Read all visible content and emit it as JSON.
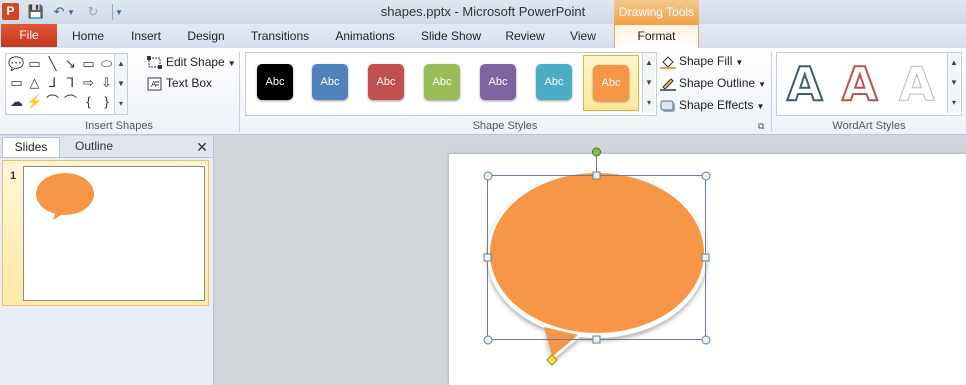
{
  "window": {
    "title": "shapes.pptx  -  Microsoft PowerPoint",
    "app_icon": "P",
    "contextual_group": "Drawing Tools"
  },
  "qat": {
    "save_icon": "💾",
    "undo_icon": "↶",
    "undo_dropdown": "▾",
    "redo_icon": "↻",
    "customize_icon": "▾"
  },
  "tabs": [
    {
      "label": "File"
    },
    {
      "label": "Home"
    },
    {
      "label": "Insert"
    },
    {
      "label": "Design"
    },
    {
      "label": "Transitions"
    },
    {
      "label": "Animations"
    },
    {
      "label": "Slide Show"
    },
    {
      "label": "Review"
    },
    {
      "label": "View"
    },
    {
      "label": "Format"
    }
  ],
  "ribbon": {
    "insert_shapes": {
      "label": "Insert Shapes",
      "shapes": [
        "💬",
        "▭",
        "╲",
        "↘",
        "▭",
        "⬭",
        "▭",
        "△",
        "⅃",
        "⅂",
        "⇨",
        "⇩",
        "☁",
        "⚡",
        "⌒",
        "⌒",
        "{",
        "}"
      ],
      "edit_shape": "Edit Shape",
      "text_box": "Text Box"
    },
    "shape_styles": {
      "label": "Shape Styles",
      "swatches": [
        {
          "text": "Abc",
          "color": "#000000"
        },
        {
          "text": "Abc",
          "color": "#4f81bd"
        },
        {
          "text": "Abc",
          "color": "#c0504d"
        },
        {
          "text": "Abc",
          "color": "#9bbb59"
        },
        {
          "text": "Abc",
          "color": "#8064a2"
        },
        {
          "text": "Abc",
          "color": "#4bacc6"
        },
        {
          "text": "Abc",
          "color": "#f79646"
        }
      ],
      "selected_index": 6,
      "shape_fill": "Shape Fill",
      "shape_outline": "Shape Outline",
      "shape_effects": "Shape Effects"
    },
    "wordart": {
      "label": "WordArt Styles",
      "letters": [
        "A",
        "A",
        "A"
      ]
    }
  },
  "slides_pane": {
    "tab_slides": "Slides",
    "tab_outline": "Outline",
    "close_icon": "✕",
    "slide_number": "1"
  },
  "colors": {
    "accent_orange": "#f79646",
    "file_tab": "#c4361d"
  }
}
